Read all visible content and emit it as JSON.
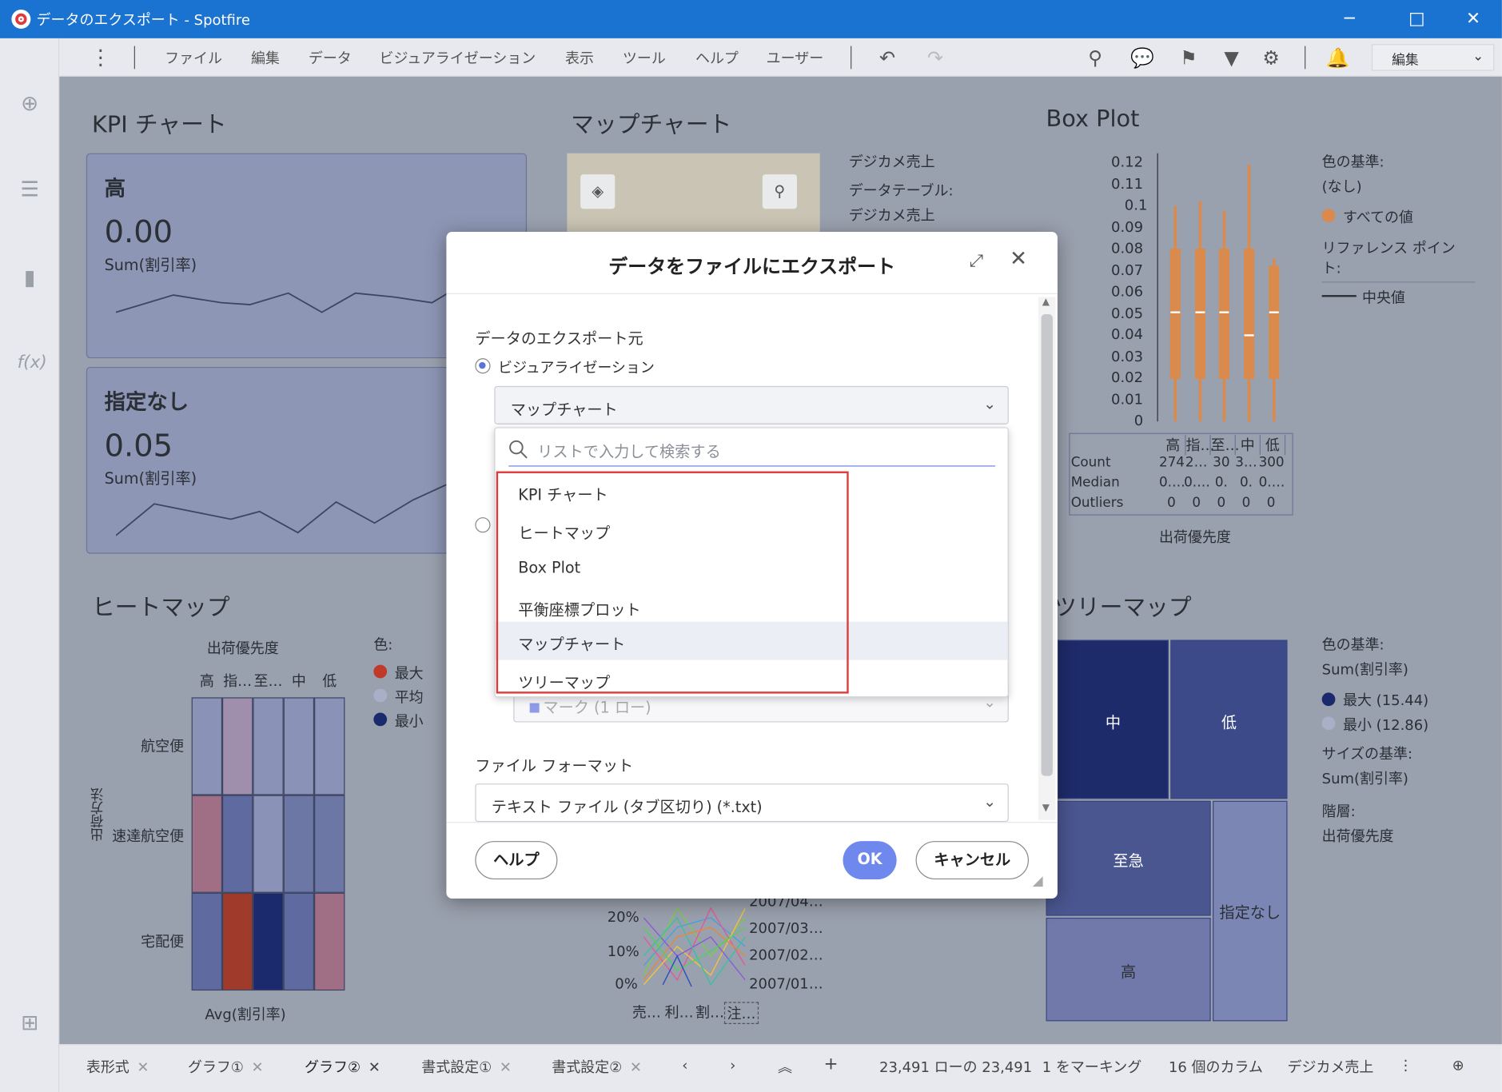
{
  "window": {
    "title": "データのエクスポート - Spotfire",
    "controls": [
      "─",
      "□",
      "✕"
    ]
  },
  "menu": {
    "items": [
      "ファイル",
      "編集",
      "データ",
      "ビジュアライゼーション",
      "表示",
      "ツール",
      "ヘルプ",
      "ユーザー"
    ],
    "mode_select": "編集"
  },
  "panels": {
    "kpi": {
      "title": "KPI チャート",
      "cards": [
        {
          "label": "高",
          "value": "0.00",
          "sub": "Sum(割引率)"
        },
        {
          "label": "指定なし",
          "value": "0.05",
          "sub": "Sum(割引率)"
        }
      ]
    },
    "map": {
      "title": "マップチャート",
      "legend": [
        "デジカメ売上",
        "データテーブル:",
        "デジカメ売上"
      ]
    },
    "boxplot": {
      "title": "Box Plot",
      "yticks": [
        "0.12",
        "0.11",
        "0.1",
        "0.09",
        "0.08",
        "0.07",
        "0.06",
        "0.05",
        "0.04",
        "0.03",
        "0.02",
        "0.01",
        "0"
      ],
      "categories": [
        "高",
        "指…",
        "至…",
        "中",
        "低"
      ],
      "table_rows": [
        {
          "label": "Count",
          "cells": [
            "274",
            "2…",
            "30",
            "3…",
            "300"
          ]
        },
        {
          "label": "Median",
          "cells": [
            "0.…",
            "0.…",
            "0.",
            "0.",
            "0.…"
          ]
        },
        {
          "label": "Outliers",
          "cells": [
            "0",
            "0",
            "0",
            "0",
            "0"
          ]
        }
      ],
      "xlabel": "出荷優先度",
      "legend_color_title": "色の基準:",
      "legend_color_value": "(なし)",
      "legend_all": "すべての値",
      "legend_ref": "リファレンス ポイント:",
      "legend_median": "中央値"
    },
    "heatmap": {
      "title": "ヒートマップ",
      "col_title": "出荷優先度",
      "cols": [
        "高",
        "指…",
        "至…",
        "中",
        "低"
      ],
      "rows": [
        "航空便",
        "速達航空便",
        "宅配便"
      ],
      "row_title": "出荷方法",
      "footer": "Avg(割引率)",
      "legend_title": "色:",
      "legend": [
        "最大",
        "平均",
        "最小"
      ]
    },
    "parallel": {
      "yticks": [
        "20%",
        "10%",
        "0%"
      ],
      "dates": [
        "2007/04…",
        "2007/03…",
        "2007/02…",
        "2007/01…"
      ],
      "xlabels": [
        "売…",
        "利…",
        "割…",
        "注…"
      ]
    },
    "treemap": {
      "title": "ツリーマップ",
      "cells": [
        "中",
        "低",
        "至急",
        "指定なし",
        "高"
      ],
      "legend_color_title": "色の基準:",
      "legend_color_value": "Sum(割引率)",
      "legend_max": "最大 (15.44)",
      "legend_min": "最小 (12.86)",
      "legend_size_title": "サイズの基準:",
      "legend_size_value": "Sum(割引率)",
      "legend_hier_title": "階層:",
      "legend_hier_value": "出荷優先度"
    }
  },
  "statusbar": {
    "tabs": [
      "表形式",
      "グラフ①",
      "グラフ②",
      "書式設定①",
      "書式設定②"
    ],
    "rows": "23,491 ローの 23,491",
    "marked": "1 をマーキング",
    "columns": "16 個のカラム",
    "table": "デジカメ売上"
  },
  "dialog": {
    "title": "データをファイルにエクスポート",
    "source_label": "データのエクスポート元",
    "radio_viz": "ビジュアライゼーション",
    "selected_viz": "マップチャート",
    "search_placeholder": "リストで入力して検索する",
    "options": [
      "KPI チャート",
      "ヒートマップ",
      "Box Plot",
      "平衡座標プロット",
      "マップチャート",
      "ツリーマップ"
    ],
    "hidden_select_value": "マーク (1 ロー)",
    "format_label": "ファイル フォーマット",
    "format_value": "テキスト ファイル (タブ区切り) (*.txt)",
    "help_button": "ヘルプ",
    "ok_button": "OK",
    "cancel_button": "キャンセル"
  },
  "colors": {
    "accent": "#1a73d0",
    "primary_button": "#6f88ee",
    "highlight_box": "#e03a3a",
    "boxplot_orange": "#d98a4c",
    "heat_max": "#c0392b",
    "heat_min": "#1a2a6c"
  }
}
